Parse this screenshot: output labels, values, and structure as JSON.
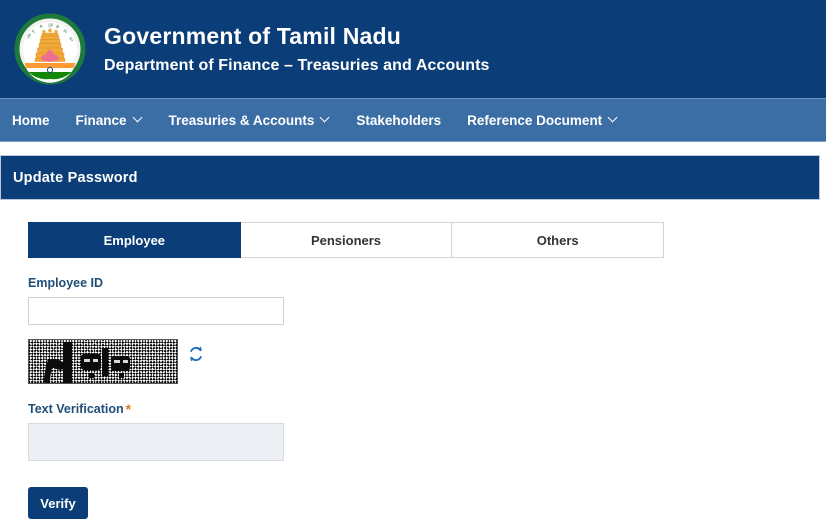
{
  "header": {
    "emblem_icon": "tamil-nadu-state-emblem",
    "gov_title": "Government of Tamil Nadu",
    "dept_title": "Department of Finance – Treasuries and Accounts"
  },
  "nav": {
    "items": [
      {
        "label": "Home",
        "has_dropdown": false
      },
      {
        "label": "Finance",
        "has_dropdown": true
      },
      {
        "label": "Treasuries & Accounts",
        "has_dropdown": true
      },
      {
        "label": "Stakeholders",
        "has_dropdown": false
      },
      {
        "label": "Reference Document",
        "has_dropdown": true
      }
    ]
  },
  "page": {
    "title": "Update Password"
  },
  "tabs": [
    {
      "label": "Employee",
      "active": true
    },
    {
      "label": "Pensioners",
      "active": false
    },
    {
      "label": "Others",
      "active": false
    }
  ],
  "form": {
    "employee_id": {
      "label": "Employee ID",
      "value": "",
      "placeholder": ""
    },
    "captcha": {
      "image_alt": "captcha-image",
      "refresh_icon": "refresh-icon"
    },
    "text_verification": {
      "label": "Text Verification",
      "required_marker": "*",
      "value": "",
      "placeholder": ""
    },
    "submit": {
      "label": "Verify"
    }
  },
  "colors": {
    "header_blue": "#0b3d78",
    "nav_blue": "#3b6ea5",
    "label_blue": "#1f4e79",
    "required_orange": "#d97b22",
    "refresh_blue": "#1f6fc4"
  }
}
